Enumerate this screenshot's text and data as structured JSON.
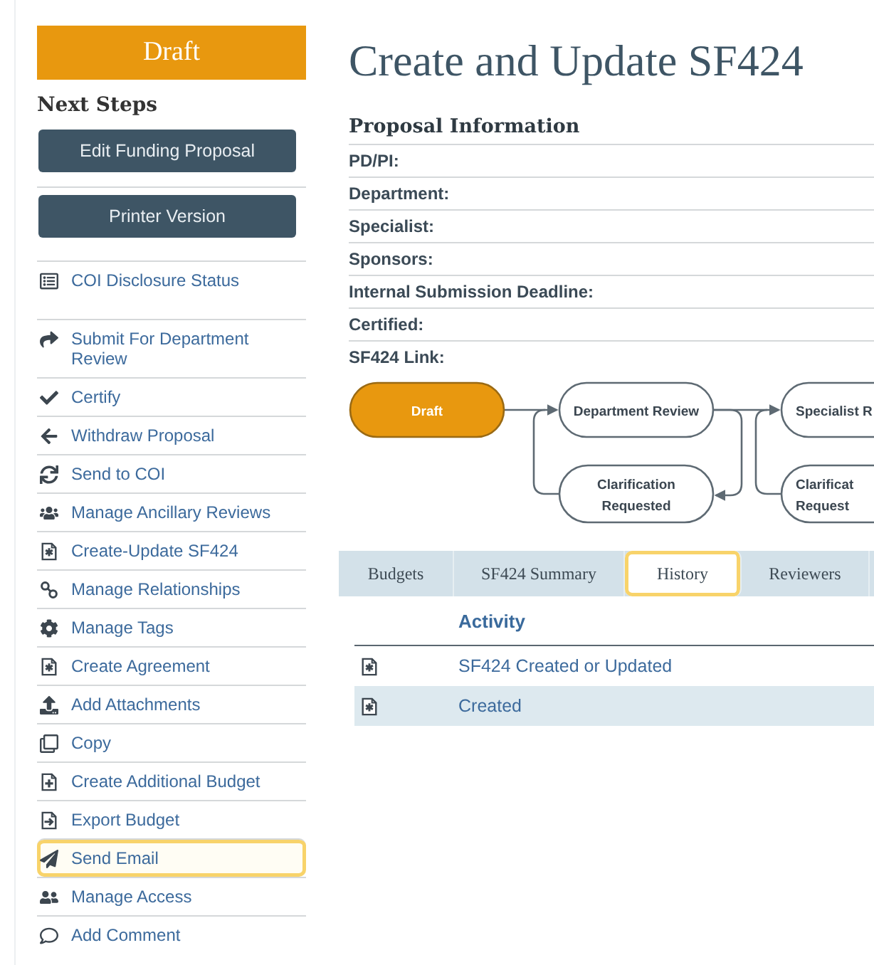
{
  "status_banner": "Draft",
  "next_steps": {
    "title": "Next Steps",
    "buttons": [
      "Edit Funding Proposal",
      "Printer Version"
    ],
    "actions": [
      {
        "label": "COI Disclosure Status",
        "highlighted": false
      },
      {
        "label": "Submit For Department Review",
        "highlighted": false
      },
      {
        "label": "Certify",
        "highlighted": false
      },
      {
        "label": "Withdraw Proposal",
        "highlighted": false
      },
      {
        "label": "Send to COI",
        "highlighted": false
      },
      {
        "label": "Manage Ancillary Reviews",
        "highlighted": false
      },
      {
        "label": "Create-Update SF424",
        "highlighted": false
      },
      {
        "label": "Manage Relationships",
        "highlighted": false
      },
      {
        "label": "Manage Tags",
        "highlighted": false
      },
      {
        "label": "Create Agreement",
        "highlighted": false
      },
      {
        "label": "Add Attachments",
        "highlighted": false
      },
      {
        "label": "Copy",
        "highlighted": false
      },
      {
        "label": "Create Additional Budget",
        "highlighted": false
      },
      {
        "label": "Export Budget",
        "highlighted": false
      },
      {
        "label": "Send Email",
        "highlighted": true
      },
      {
        "label": "Manage Access",
        "highlighted": false
      },
      {
        "label": "Add Comment",
        "highlighted": false
      }
    ]
  },
  "page_title": "Create and Update SF424",
  "proposal_information": {
    "title": "Proposal Information",
    "fields": [
      "PD/PI:",
      "Department:",
      "Specialist:",
      "Sponsors:",
      "Internal Submission Deadline:",
      "Certified:",
      "SF424 Link:"
    ]
  },
  "workflow": {
    "states": [
      {
        "lines": [
          "Draft"
        ],
        "current": true
      },
      {
        "lines": [
          "Department Review"
        ],
        "current": false
      },
      {
        "lines": [
          "Specialist R"
        ],
        "current": false
      },
      {
        "lines": [
          "Clarification",
          "Requested"
        ],
        "current": false
      },
      {
        "lines": [
          "Clarificat",
          "Request"
        ],
        "current": false
      }
    ]
  },
  "tabs": [
    {
      "label": "Budgets",
      "selected": false,
      "highlighted": false
    },
    {
      "label": "SF424 Summary",
      "selected": false,
      "highlighted": false
    },
    {
      "label": "History",
      "selected": true,
      "highlighted": true
    },
    {
      "label": "Reviewers",
      "selected": false,
      "highlighted": false
    }
  ],
  "history": {
    "columns": [
      "Activity"
    ],
    "rows": [
      "SF424 Created or Updated",
      "Created"
    ]
  }
}
